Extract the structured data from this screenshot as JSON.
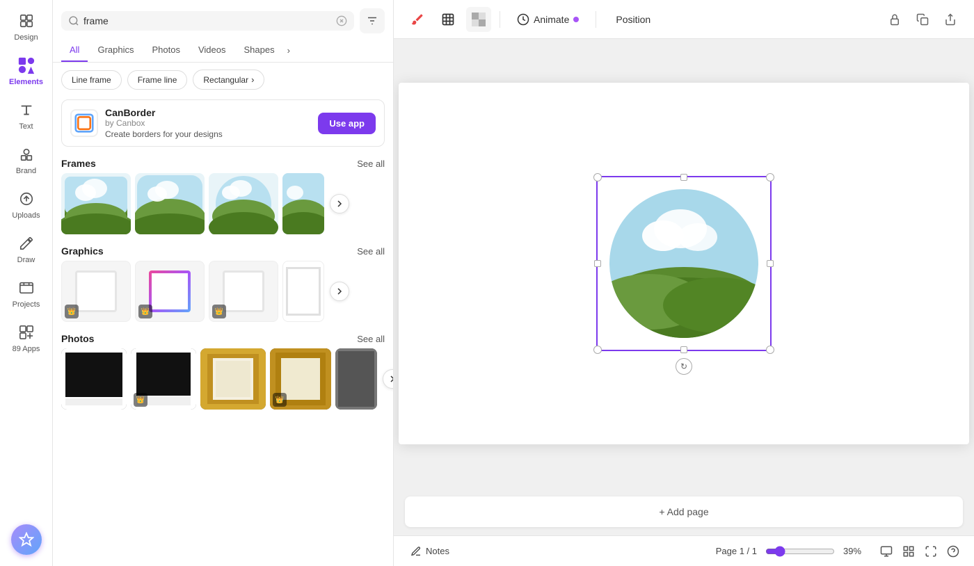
{
  "sidebar": {
    "items": [
      {
        "id": "design",
        "label": "Design",
        "icon": "design-icon"
      },
      {
        "id": "elements",
        "label": "Elements",
        "icon": "elements-icon",
        "active": true
      },
      {
        "id": "text",
        "label": "Text",
        "icon": "text-icon"
      },
      {
        "id": "brand",
        "label": "Brand",
        "icon": "brand-icon"
      },
      {
        "id": "uploads",
        "label": "Uploads",
        "icon": "uploads-icon"
      },
      {
        "id": "draw",
        "label": "Draw",
        "icon": "draw-icon"
      },
      {
        "id": "projects",
        "label": "Projects",
        "icon": "projects-icon"
      },
      {
        "id": "apps",
        "label": "Apps",
        "icon": "apps-icon",
        "count": "89"
      }
    ]
  },
  "search": {
    "value": "frame",
    "placeholder": "frame"
  },
  "tabs": [
    {
      "id": "all",
      "label": "All",
      "active": true
    },
    {
      "id": "graphics",
      "label": "Graphics"
    },
    {
      "id": "photos",
      "label": "Photos"
    },
    {
      "id": "videos",
      "label": "Videos"
    },
    {
      "id": "shapes",
      "label": "Shapes"
    },
    {
      "id": "more",
      "label": "›"
    }
  ],
  "filter_pills": [
    {
      "label": "Line frame"
    },
    {
      "label": "Frame line"
    },
    {
      "label": "Rectangular"
    },
    {
      "label": "›"
    }
  ],
  "promo": {
    "title": "CanBorder",
    "subtitle": "by Canbox",
    "description": "Create borders for your designs",
    "btn_label": "Use app"
  },
  "sections": {
    "frames": {
      "title": "Frames",
      "see_all": "See all"
    },
    "graphics": {
      "title": "Graphics",
      "see_all": "See all"
    },
    "photos": {
      "title": "Photos",
      "see_all": "See all"
    }
  },
  "toolbar": {
    "animate_label": "Animate",
    "position_label": "Position"
  },
  "canvas": {
    "add_page_label": "+ Add page"
  },
  "bottom_bar": {
    "notes_label": "Notes",
    "page_label": "Page 1 / 1",
    "zoom_value": "39",
    "zoom_pct": "39%"
  },
  "colors": {
    "accent": "#7c3aed",
    "accent_dot": "#a855f7"
  }
}
